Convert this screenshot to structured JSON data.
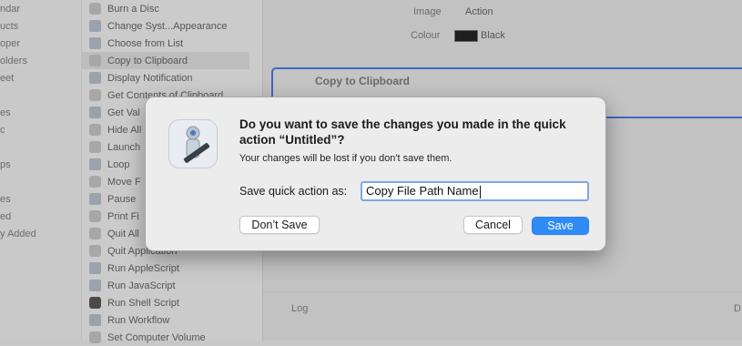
{
  "library": {
    "items": [
      "ndar",
      "ucts",
      "oper",
      "olders",
      "eet",
      "es",
      "c",
      "ps",
      "es",
      "ed",
      "y Added"
    ]
  },
  "actions": {
    "items": [
      {
        "label": "Burn a Disc"
      },
      {
        "label": "Change Syst...Appearance"
      },
      {
        "label": "Choose from List"
      },
      {
        "label": "Copy to Clipboard"
      },
      {
        "label": "Display Notification"
      },
      {
        "label": "Get Contents of Clipboard"
      },
      {
        "label": "Get Val"
      },
      {
        "label": "Hide All"
      },
      {
        "label": "Launch"
      },
      {
        "label": "Loop"
      },
      {
        "label": "Move F"
      },
      {
        "label": "Pause"
      },
      {
        "label": "Print Fi"
      },
      {
        "label": "Quit All"
      },
      {
        "label": "Quit Application"
      },
      {
        "label": "Run AppleScript"
      },
      {
        "label": "Run JavaScript"
      },
      {
        "label": "Run Shell Script"
      },
      {
        "label": "Run Workflow"
      },
      {
        "label": "Set Computer Volume"
      }
    ]
  },
  "workflow": {
    "image_label": "Image",
    "image_value": "Action",
    "colour_label": "Colour",
    "colour_value": "Black",
    "action_title": "Copy to Clipboard",
    "log_label": "Log",
    "log_right": "D"
  },
  "dialog": {
    "title": "Do you want to save the changes you made in the quick action “Untitled”?",
    "message": "Your changes will be lost if you don't save them.",
    "field_label": "Save quick action as:",
    "field_value": "Copy File Path Name",
    "dont_save": "Don’t Save",
    "cancel": "Cancel",
    "save": "Save"
  }
}
